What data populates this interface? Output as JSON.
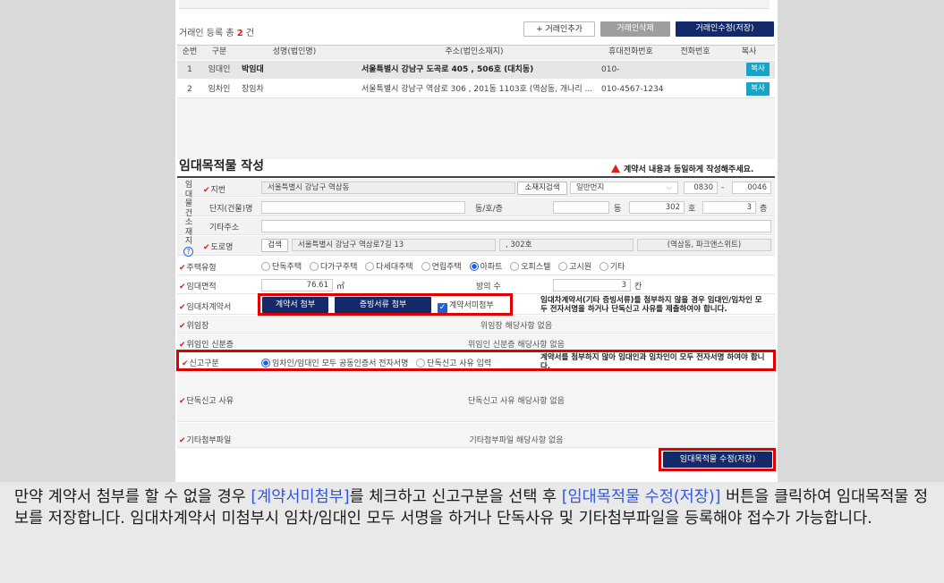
{
  "lessor_section": {
    "registered_prefix": "거래인 등록 총 ",
    "registered_count": "2",
    "registered_suffix": " 건",
    "buttons": {
      "add": "+ 거래인추가",
      "delete": "거래인삭제",
      "save": "거래인수정(저장)"
    },
    "columns": [
      "순번",
      "구분",
      "성명(법인명)",
      "주소(법인소재지)",
      "휴대전화번호",
      "전화번호",
      "복사"
    ],
    "rows": [
      {
        "no": "1",
        "type": "임대인",
        "name": "박임대",
        "address": "서울특별시 강남구 도곡로 405 , 506호 (대치동)",
        "mobile": "010-",
        "phone": "",
        "copy": "복사"
      },
      {
        "no": "2",
        "type": "임차인",
        "name": "장임차",
        "address": "서울특별시 강남구 역삼로 306 , 201동 1103호 (역삼동, 개나리 ...",
        "mobile": "010-4567-1234",
        "phone": "",
        "copy": "복사"
      }
    ]
  },
  "property_section": {
    "title": "임대목적물 작성",
    "warning": "계약서 내용과 동일하게 작성해주세요.",
    "vertical_label": [
      "임",
      "대",
      "물",
      "건",
      "소",
      "재",
      "지"
    ],
    "lot": {
      "label": "지번",
      "value": "서울특별시 강남구 역삼동",
      "search_button": "소재지검색",
      "type_select": "일반번지",
      "main_no": "0830",
      "dash": "-",
      "sub_no": "0046"
    },
    "complex": {
      "label": "단지(건물)명",
      "value": "",
      "dong_label": "동/호/층",
      "dong_value": "",
      "dong_unit": "동",
      "ho_value": "302",
      "ho_unit": "호",
      "floor_value": "3",
      "floor_unit": "층"
    },
    "other_address": {
      "label": "기타주소",
      "value": ""
    },
    "road": {
      "label": "도로명",
      "search_button": "검색",
      "value": "서울특별시 강남구 역삼로7길 13",
      "detail": ", 302호",
      "extra": "(역삼동, 파크앤스위트)"
    },
    "housing_type": {
      "label": "주택유형",
      "options": [
        "단독주택",
        "다가구주택",
        "다세대주택",
        "연립주택",
        "아파트",
        "오피스텔",
        "고시원",
        "기타"
      ],
      "selected": "아파트"
    },
    "area": {
      "label": "임대면적",
      "value": "76.61",
      "unit": "㎡",
      "rooms_label": "방의 수",
      "rooms_value": "3",
      "rooms_unit": "칸"
    },
    "contract": {
      "label": "임대차계약서",
      "attach_button": "계약서 첨부",
      "evidence_button": "증빙서류 첨부",
      "checkbox_label": "계약서미첨부",
      "checked": true,
      "note": "임대차계약서(기타 증빙서류)를 첨부하지 않을 경우 임대인/임차인 모두 전자서명을 하거나 단독신고 사유를 제출하여야 합니다."
    },
    "delegation": {
      "label": "위임장",
      "value": "위임장 해당사항 없음"
    },
    "delegate_id": {
      "label": "위임인 신분증",
      "value": "위임인 신분증 해당사항 없음"
    },
    "report_type": {
      "label": "신고구분",
      "options": [
        "임차인/임대인 모두 공동인증서 전자서명",
        "단독신고 사유 입력"
      ],
      "selected": "임차인/임대인 모두 공동인증서 전자서명",
      "note": "계약서를 첨부하지 않아 임대인과 임차인이 모두 전자서명 하여야 합니다."
    },
    "sole_reason": {
      "label": "단독신고 사유",
      "value": "단독신고 사유 해당사항 없음"
    },
    "other_files": {
      "label": "기타첨부파일",
      "value": "기타첨부파일 해당사항 없음"
    },
    "save_button": "임대목적물 수정(저장)"
  },
  "description": {
    "part1": "만약 계약서 첨부를 할 수 없을 경우 ",
    "hl1": "[계약서미첨부]",
    "part2": "를 체크하고 신고구분을 선택 후 ",
    "hl2": "[임대목적물 수정(저장)]",
    "part3": " 버튼을 클릭하여 임대목적물 정보를 저장합니다. 임대차계약서 미첨부시 임차/임대인 모두 서명을 하거나 단독사유 및 기타첨부파일을 등록해야 접수가 가능합니다."
  },
  "colors": {
    "accent_navy": "#13296a",
    "highlight_red": "#e00000",
    "copy_teal": "#1aa3c5",
    "link_blue": "#2f57e3"
  }
}
